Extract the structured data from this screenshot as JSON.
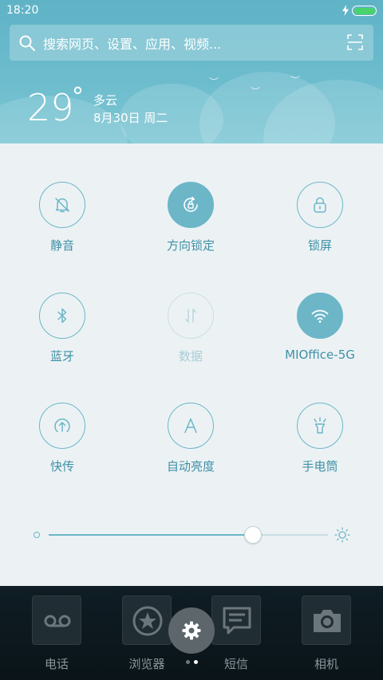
{
  "status": {
    "time": "18:20"
  },
  "search": {
    "placeholder": "搜索网页、设置、应用、视频..."
  },
  "weather": {
    "temperature": "29",
    "degree": "°",
    "condition": "多云",
    "date": "8月30日 周二"
  },
  "toggles": [
    {
      "id": "mute",
      "label": "静音",
      "icon": "bell-off-icon",
      "state": "off"
    },
    {
      "id": "rotation",
      "label": "方向锁定",
      "icon": "rotation-lock-icon",
      "state": "on"
    },
    {
      "id": "lock",
      "label": "锁屏",
      "icon": "lock-icon",
      "state": "off"
    },
    {
      "id": "bluetooth",
      "label": "蓝牙",
      "icon": "bluetooth-icon",
      "state": "off"
    },
    {
      "id": "data",
      "label": "数据",
      "icon": "data-arrows-icon",
      "state": "disabled"
    },
    {
      "id": "wifi",
      "label": "MIOffice-5G",
      "icon": "wifi-icon",
      "state": "on"
    },
    {
      "id": "share",
      "label": "快传",
      "icon": "upload-icon",
      "state": "off"
    },
    {
      "id": "brightness",
      "label": "自动亮度",
      "icon": "auto-brightness-icon",
      "state": "off"
    },
    {
      "id": "flashlight",
      "label": "手电筒",
      "icon": "flashlight-icon",
      "state": "off"
    }
  ],
  "brightness_slider": {
    "value": 0.73
  },
  "dock": {
    "apps": [
      {
        "label": "电话",
        "icon": "voicemail-icon"
      },
      {
        "label": "浏览器",
        "icon": "star-icon"
      },
      {
        "label": "短信",
        "icon": "message-icon"
      },
      {
        "label": "相机",
        "icon": "camera-icon"
      }
    ],
    "page_indicator": {
      "pages": 2,
      "active": 1
    }
  },
  "colors": {
    "accent": "#6cb6c8",
    "panel": "#ecf2f4",
    "header": "#68b9cb",
    "battery": "#49d36d"
  }
}
